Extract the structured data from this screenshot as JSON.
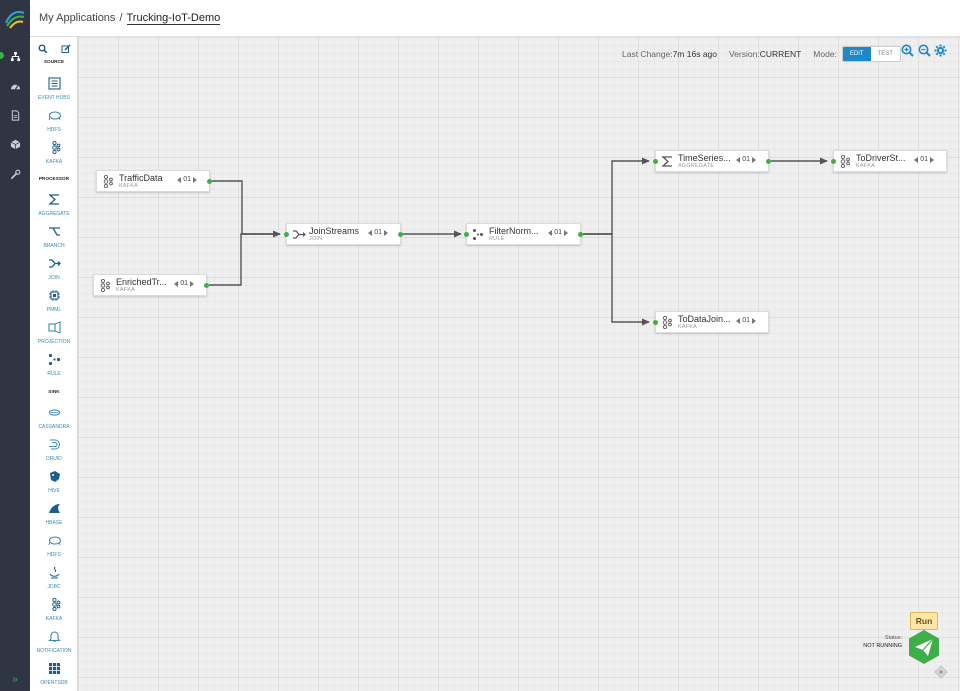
{
  "breadcrumb": {
    "parent": "My Applications",
    "separator": "/",
    "app_name": "Trucking-IoT-Demo"
  },
  "topbar": {
    "last_change_label": "Last Change:",
    "last_change_value": "7m 16s ago",
    "version_label": "Version:",
    "version_value": "CURRENT",
    "mode_label": "Mode:",
    "mode_edit": "EDIT",
    "mode_test": "TEST"
  },
  "palette": {
    "sections": {
      "source": "SOURCE",
      "processor": "PROCESSOR",
      "sink": "SINK"
    },
    "items": [
      {
        "label": "EVENT HUBS",
        "icon": "event-hubs-icon"
      },
      {
        "label": "HDFS",
        "icon": "hdfs-icon"
      },
      {
        "label": "KAFKA",
        "icon": "kafka-icon"
      },
      {
        "label": "AGGREGATE",
        "icon": "aggregate-icon"
      },
      {
        "label": "BRANCH",
        "icon": "branch-icon"
      },
      {
        "label": "JOIN",
        "icon": "join-icon"
      },
      {
        "label": "PMML",
        "icon": "pmml-icon"
      },
      {
        "label": "PROJECTION",
        "icon": "projection-icon"
      },
      {
        "label": "RULE",
        "icon": "rule-icon"
      },
      {
        "label": "CASSANDRA",
        "icon": "cassandra-icon"
      },
      {
        "label": "DRUID",
        "icon": "druid-icon"
      },
      {
        "label": "HIVE",
        "icon": "hive-icon"
      },
      {
        "label": "HBASE",
        "icon": "hbase-icon"
      },
      {
        "label": "HDFS",
        "icon": "hdfs-icon"
      },
      {
        "label": "JDBC",
        "icon": "jdbc-icon"
      },
      {
        "label": "KAFKA",
        "icon": "kafka-icon"
      },
      {
        "label": "NOTIFICATION",
        "icon": "notification-icon"
      },
      {
        "label": "OPENTSDB",
        "icon": "opentsdb-icon"
      }
    ]
  },
  "nodes": [
    {
      "title": "TrafficData",
      "type": "KAFKA",
      "parallelism": "01"
    },
    {
      "title": "EnrichedTr...",
      "type": "KAFKA",
      "parallelism": "01"
    },
    {
      "title": "JoinStreams",
      "type": "JOIN",
      "parallelism": "01"
    },
    {
      "title": "FilterNorm...",
      "type": "RULE",
      "parallelism": "01"
    },
    {
      "title": "TimeSeries...",
      "type": "AGGREGATE",
      "parallelism": "01"
    },
    {
      "title": "ToDriverSt...",
      "type": "KAFKA",
      "parallelism": "01"
    },
    {
      "title": "ToDataJoin...",
      "type": "KAFKA",
      "parallelism": "01"
    }
  ],
  "status": {
    "label": "Status:",
    "value": "NOT RUNNING"
  },
  "run": {
    "label": "Run"
  },
  "colors": {
    "accent": "#3fae49",
    "mode_active": "#1e88c9",
    "nav_bg": "#2f3542",
    "link": "#3a8bb8"
  }
}
